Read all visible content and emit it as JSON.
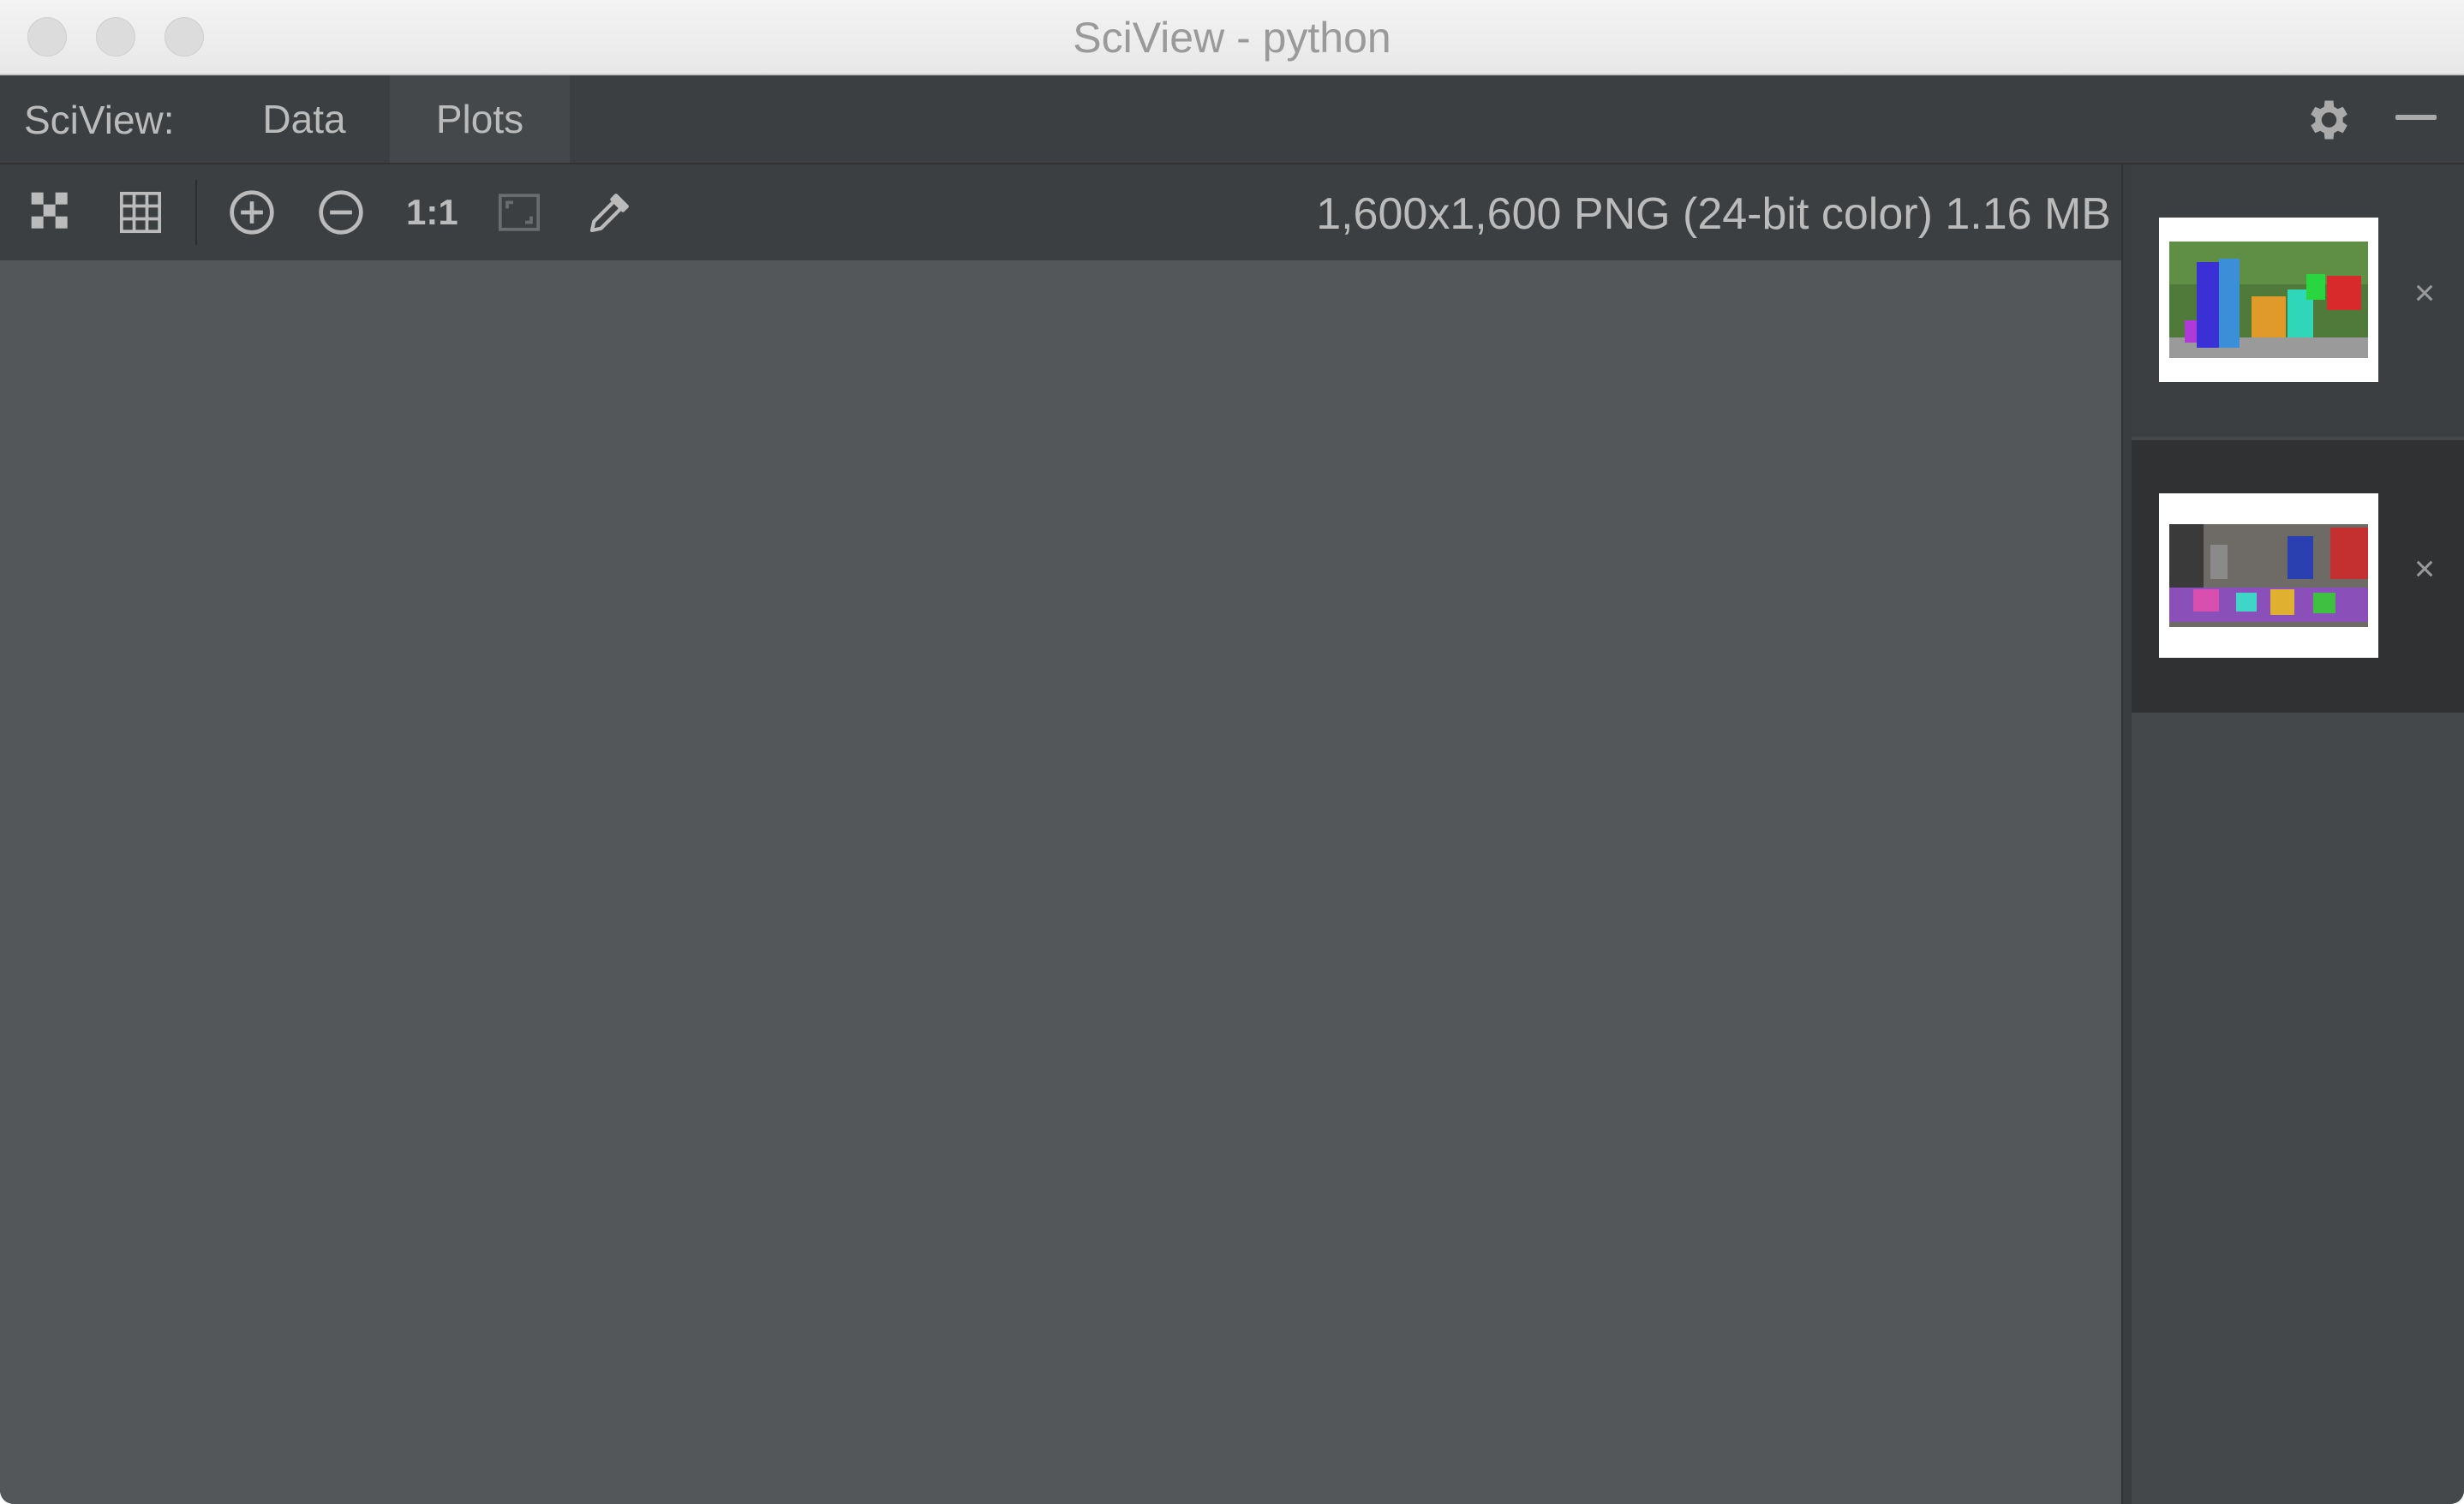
{
  "window": {
    "title": "SciView - python"
  },
  "tabbar": {
    "label": "SciView:",
    "tabs": [
      {
        "label": "Data",
        "selected": false
      },
      {
        "label": "Plots",
        "selected": true
      }
    ],
    "settings_icon": "gear-icon",
    "minimize_icon": "minimize-icon"
  },
  "toolbar": {
    "icons": [
      "chessboard-icon",
      "grid-icon",
      "zoom-in-icon",
      "zoom-out-icon",
      "actual-size-icon",
      "fit-zoom-icon",
      "color-picker-icon"
    ],
    "actual_size_label": "1:1",
    "image_info": "1,600x1,600 PNG (24-bit color) 1.16 MB"
  },
  "thumbnails": {
    "items": [
      {
        "name": "segmentation-thumbnail-1",
        "close": "×"
      },
      {
        "name": "segmentation-thumbnail-2",
        "close": "×"
      }
    ]
  },
  "colors": {
    "canvas": "#53575a",
    "panel": "#3c3f41",
    "text": "#bbbbbb"
  }
}
